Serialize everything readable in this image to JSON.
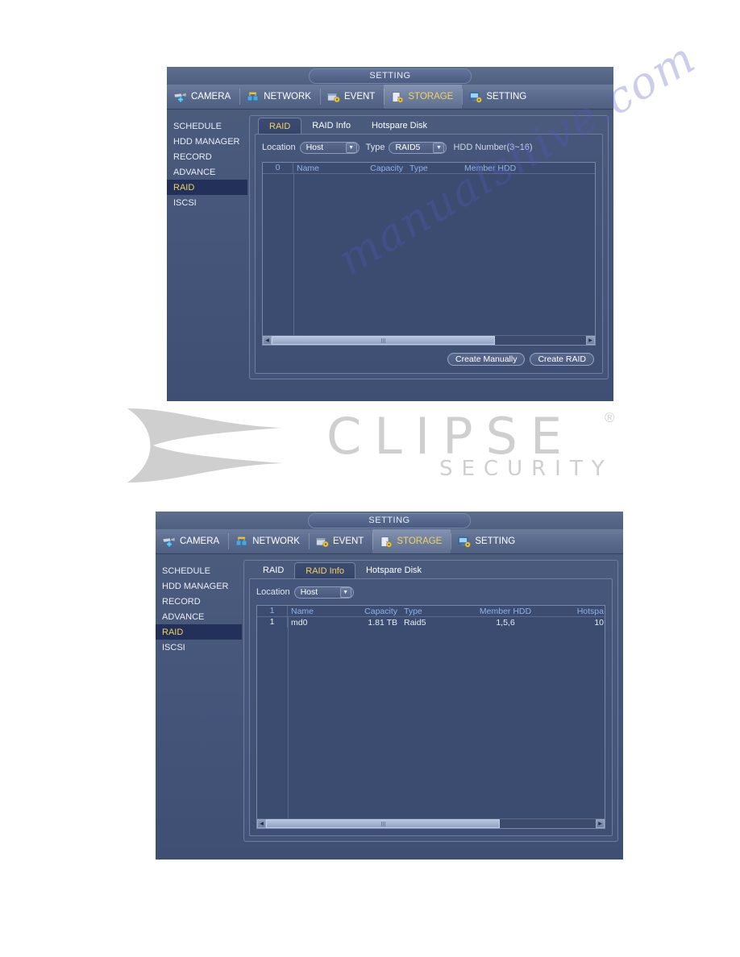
{
  "watermark": {
    "brand": "CLIPSE",
    "subtitle": "SECURITY",
    "registered": "®",
    "script_1": "manualshive.com",
    "script_2": "manualshive.com"
  },
  "panel_1": {
    "title": "SETTING",
    "nav_tabs": [
      {
        "label": "CAMERA",
        "icon": "camera-icon",
        "active": false
      },
      {
        "label": "NETWORK",
        "icon": "network-icon",
        "active": false
      },
      {
        "label": "EVENT",
        "icon": "event-icon",
        "active": false
      },
      {
        "label": "STORAGE",
        "icon": "storage-icon",
        "active": true
      },
      {
        "label": "SETTING",
        "icon": "setting-icon",
        "active": false
      }
    ],
    "sidebar": [
      {
        "label": "SCHEDULE",
        "active": false
      },
      {
        "label": "HDD MANAGER",
        "active": false
      },
      {
        "label": "RECORD",
        "active": false
      },
      {
        "label": "ADVANCE",
        "active": false
      },
      {
        "label": "RAID",
        "active": true
      },
      {
        "label": "ISCSI",
        "active": false
      }
    ],
    "sub_tabs": [
      {
        "label": "RAID",
        "active": true
      },
      {
        "label": "RAID Info",
        "active": false
      },
      {
        "label": "Hotspare Disk",
        "active": false
      }
    ],
    "form": {
      "location_label": "Location",
      "location_value": "Host",
      "type_label": "Type",
      "type_value": "RAID5",
      "hdd_number_hint": "HDD Number(3~16)",
      "arrow_glyph": "▼"
    },
    "table": {
      "index_header": "0",
      "headers": [
        "Name",
        "Capacity",
        "Type",
        "Member HDD"
      ],
      "rows": []
    },
    "scrollbar": {
      "left_glyph": "◀",
      "right_glyph": "▶"
    },
    "buttons": [
      {
        "label": "Create Manually"
      },
      {
        "label": "Create RAID"
      }
    ]
  },
  "panel_2": {
    "title": "SETTING",
    "nav_tabs": [
      {
        "label": "CAMERA",
        "icon": "camera-icon",
        "active": false
      },
      {
        "label": "NETWORK",
        "icon": "network-icon",
        "active": false
      },
      {
        "label": "EVENT",
        "icon": "event-icon",
        "active": false
      },
      {
        "label": "STORAGE",
        "icon": "storage-icon",
        "active": true
      },
      {
        "label": "SETTING",
        "icon": "setting-icon",
        "active": false
      }
    ],
    "sidebar": [
      {
        "label": "SCHEDULE",
        "active": false
      },
      {
        "label": "HDD MANAGER",
        "active": false
      },
      {
        "label": "RECORD",
        "active": false
      },
      {
        "label": "ADVANCE",
        "active": false
      },
      {
        "label": "RAID",
        "active": true
      },
      {
        "label": "ISCSI",
        "active": false
      }
    ],
    "sub_tabs": [
      {
        "label": "RAID",
        "active": false
      },
      {
        "label": "RAID Info",
        "active": true
      },
      {
        "label": "Hotspare Disk",
        "active": false
      }
    ],
    "form": {
      "location_label": "Location",
      "location_value": "Host",
      "arrow_glyph": "▼"
    },
    "table": {
      "index_header": "1",
      "headers": [
        "Name",
        "Capacity",
        "Type",
        "Member HDD",
        "Hotspa"
      ],
      "rows": [
        {
          "index": "1",
          "name": "md0",
          "capacity": "1.81 TB",
          "type": "Raid5",
          "member_hdd": "1,5,6",
          "hotspare": "10"
        }
      ]
    },
    "scrollbar": {
      "left_glyph": "◀",
      "right_glyph": "▶"
    }
  },
  "colors": {
    "panel_bg": "#45557a",
    "accent_yellow": "#f2d261",
    "header_blue": "#8fb2e8",
    "text_white": "#ffffff",
    "sidebar_active_bg": "#22305a"
  }
}
